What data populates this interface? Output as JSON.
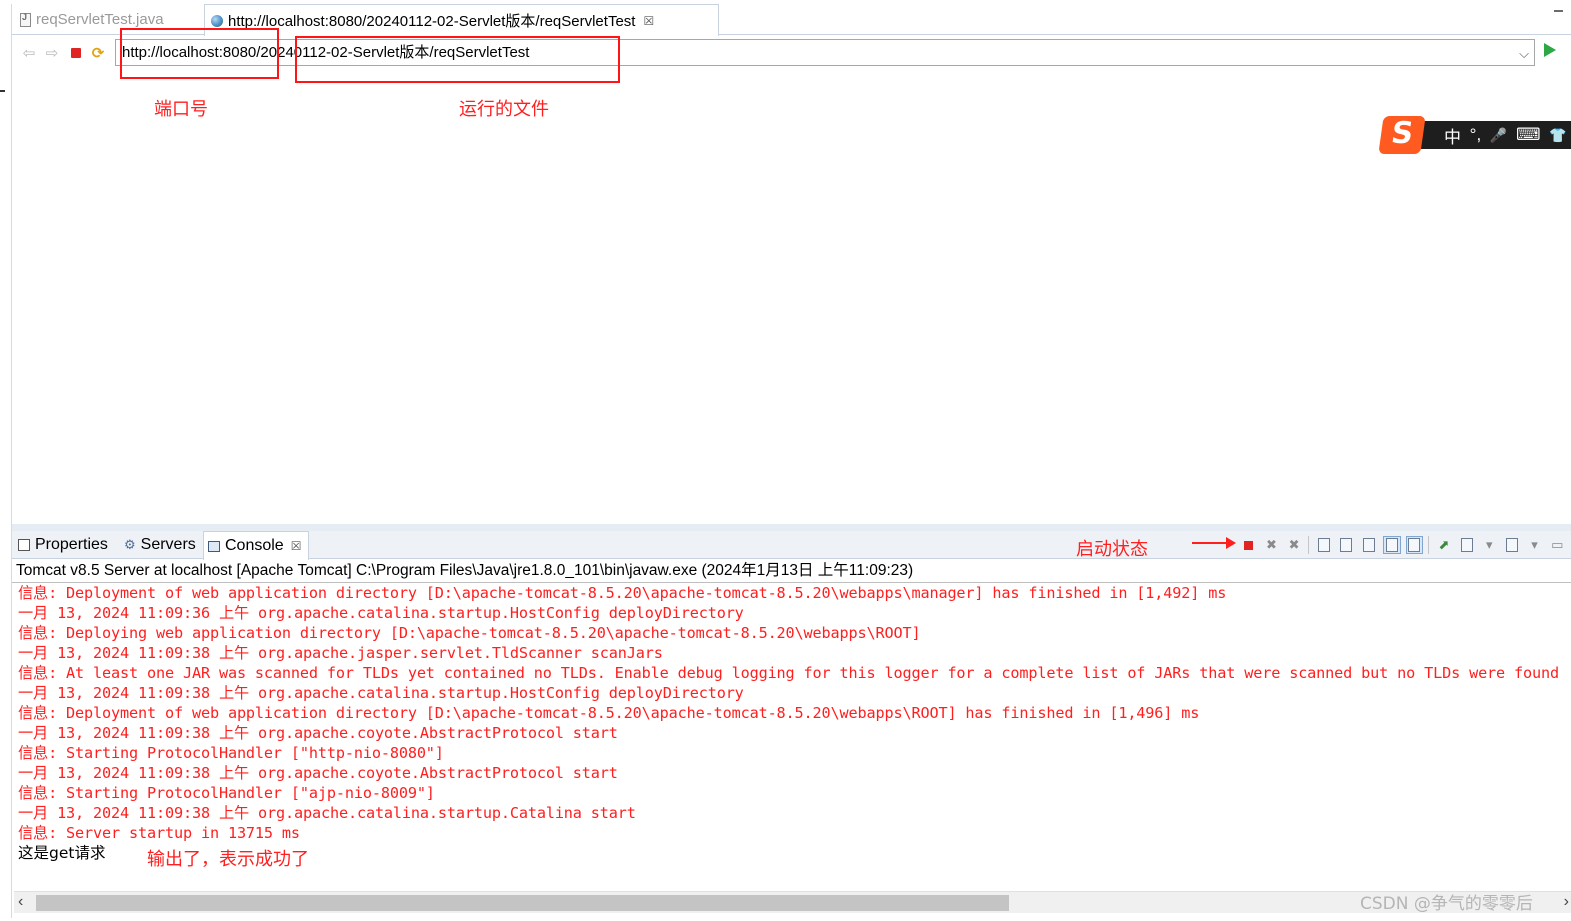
{
  "editor_tabs": {
    "java_tab_label": "reqServletTest.java",
    "browser_tab_label": "http://localhost:8080/20240112-02-Servlet版本/reqServletTest",
    "close_glyph": "☒"
  },
  "browser": {
    "url": "http://localhost:8080/20240112-02-Servlet版本/reqServletTest"
  },
  "annotations": {
    "port": "端口号",
    "file": "运行的文件",
    "status": "启动状态",
    "output": "输出了，表示成功了"
  },
  "ime": {
    "logo": "S",
    "mode": "中",
    "punct": "°,",
    "mic": "🎤",
    "keyboard": "⌨",
    "skin": "👕"
  },
  "view_tabs": {
    "properties": "Properties",
    "servers": "Servers",
    "console": "Console"
  },
  "console": {
    "header": "Tomcat v8.5 Server at localhost [Apache Tomcat] C:\\Program Files\\Java\\jre1.8.0_101\\bin\\javaw.exe (2024年1月13日 上午11:09:23)",
    "lines": [
      "信息: Deployment of web application directory [D:\\apache-tomcat-8.5.20\\apache-tomcat-8.5.20\\webapps\\manager] has finished in [1,492] ms",
      "一月 13, 2024 11:09:36 上午 org.apache.catalina.startup.HostConfig deployDirectory",
      "信息: Deploying web application directory [D:\\apache-tomcat-8.5.20\\apache-tomcat-8.5.20\\webapps\\ROOT]",
      "一月 13, 2024 11:09:38 上午 org.apache.jasper.servlet.TldScanner scanJars",
      "信息: At least one JAR was scanned for TLDs yet contained no TLDs. Enable debug logging for this logger for a complete list of JARs that were scanned but no TLDs were found",
      "一月 13, 2024 11:09:38 上午 org.apache.catalina.startup.HostConfig deployDirectory",
      "信息: Deployment of web application directory [D:\\apache-tomcat-8.5.20\\apache-tomcat-8.5.20\\webapps\\ROOT] has finished in [1,496] ms",
      "一月 13, 2024 11:09:38 上午 org.apache.coyote.AbstractProtocol start",
      "信息: Starting ProtocolHandler [\"http-nio-8080\"]",
      "一月 13, 2024 11:09:38 上午 org.apache.coyote.AbstractProtocol start",
      "信息: Starting ProtocolHandler [\"ajp-nio-8009\"]",
      "一月 13, 2024 11:09:38 上午 org.apache.catalina.startup.Catalina start",
      "信息: Server startup in 13715 ms"
    ],
    "output": "这是get请求"
  },
  "watermark": "CSDN @争气的零零后",
  "colors": {
    "log_red": "#ff1f1f",
    "annotation_red": "#ff1f1f",
    "go_green": "#2ca845"
  }
}
